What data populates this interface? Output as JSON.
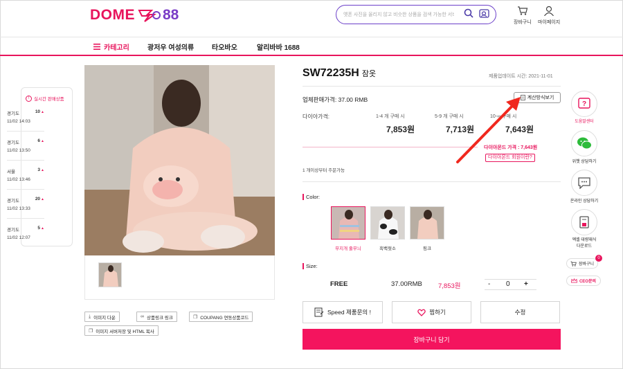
{
  "header": {
    "logo_text": "DOME",
    "logo_num": "88",
    "search_placeholder": "옛폰 사진을 올리지 않고 비슷한 상품을 검색 가능한 서비스",
    "cart_label": "장바구니",
    "mypage_label": "마이페이지"
  },
  "nav": {
    "items": [
      "카테고리",
      "광저우 여성의류",
      "타오바오",
      "알리바바 1688"
    ]
  },
  "live_sales": {
    "title": "실시간 판매상품",
    "items": [
      {
        "region": "경기도",
        "count": "10",
        "time": "11/02 14:03"
      },
      {
        "region": "경기도",
        "count": "6",
        "time": "11/02 13:50"
      },
      {
        "region": "서울",
        "count": "3",
        "time": "11/02 13:46"
      },
      {
        "region": "경기도",
        "count": "20",
        "time": "11/02 13:33"
      },
      {
        "region": "경기도",
        "count": "5",
        "time": "11/02 12:07"
      }
    ]
  },
  "image_actions": {
    "download": "이미지 다운",
    "link": "상품링크 링크",
    "coupang": "COUPANG 연동상품코드",
    "server": "이미지 서버저장 및 HTML 복사"
  },
  "product": {
    "code": "SW72235H",
    "name": "잠옷",
    "update_label": "제품업데이트 시간:",
    "update_date": "2021-11-01",
    "wholesale": "업체판매가격: 37.00 RMB",
    "calc_button": "계산방식보기",
    "dia_label": "다이아가격:",
    "tiers": [
      {
        "range": "1-4 개 구매 시",
        "price": "7,853원"
      },
      {
        "range": "5-9 개 구매 시",
        "price": "7,713원"
      },
      {
        "range": "10-∞ 구매 시",
        "price": "7,643원"
      }
    ],
    "dia_price": "다이아몬드 가격 : 7,643원",
    "dia_member": "다이아몬드 회원이란?",
    "min_order": "1 개이상부터 주문가능"
  },
  "color": {
    "label": "Color:",
    "options": [
      "무지개 줄무늬",
      "흑백젖소",
      "핑크"
    ],
    "selected": 0
  },
  "size": {
    "label": "Size:",
    "name": "FREE",
    "rmb": "37.00RMB",
    "price": "7,853원",
    "minus": "-",
    "qty": "0",
    "plus": "+"
  },
  "actions": {
    "speed": "Speed 제품문의 !",
    "wish": "찜하기",
    "edit": "수정",
    "cart": "장바구니 담기"
  },
  "rail": {
    "help": "도움말센터",
    "wechat": "위챗 상담하기",
    "online": "온라인 상담하기",
    "bulk_line1": "엑셀 대량재식",
    "bulk_line2": "다운로드",
    "cart": "장바구니",
    "cart_badge": "0",
    "ceo": "CEO문의"
  },
  "colors": {
    "brand": "#e8145c",
    "accent": "#6b3fc9",
    "arrow": "#f0281e"
  }
}
